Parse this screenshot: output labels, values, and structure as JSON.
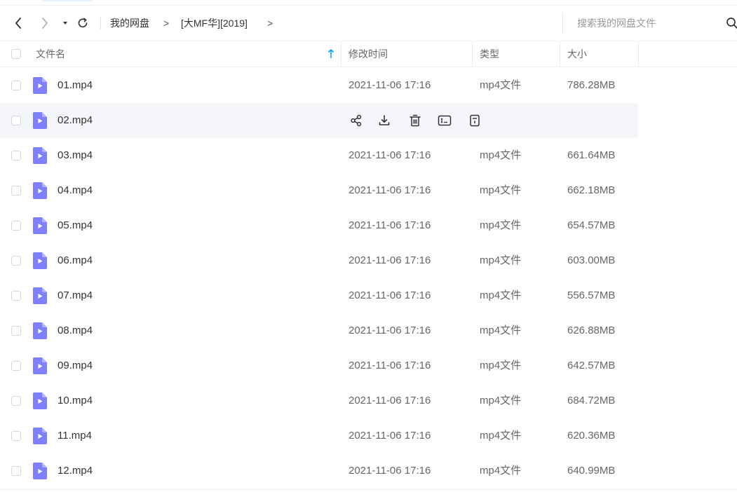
{
  "breadcrumb": {
    "root": "我的网盘",
    "separator": ">",
    "folder": "[大MF华][2019]",
    "trailing": ">"
  },
  "search": {
    "placeholder": "搜索我的网盘文件"
  },
  "columns": {
    "name": "文件名",
    "modified": "修改时间",
    "type": "类型",
    "size": "大小"
  },
  "sort": {
    "column": "name",
    "direction": "ascending"
  },
  "colors": {
    "accent": "#06a7ff",
    "file_icon": "#7e7ffa",
    "hover_row": "#f5f6fa"
  },
  "files": [
    {
      "name": "01.mp4",
      "modified": "2021-11-06 17:16",
      "type": "mp4文件",
      "size": "786.28MB"
    },
    {
      "name": "02.mp4",
      "modified": "",
      "type": "",
      "size": "",
      "hovered": true
    },
    {
      "name": "03.mp4",
      "modified": "2021-11-06 17:16",
      "type": "mp4文件",
      "size": "661.64MB"
    },
    {
      "name": "04.mp4",
      "modified": "2021-11-06 17:16",
      "type": "mp4文件",
      "size": "662.18MB"
    },
    {
      "name": "05.mp4",
      "modified": "2021-11-06 17:16",
      "type": "mp4文件",
      "size": "654.57MB"
    },
    {
      "name": "06.mp4",
      "modified": "2021-11-06 17:16",
      "type": "mp4文件",
      "size": "603.00MB"
    },
    {
      "name": "07.mp4",
      "modified": "2021-11-06 17:16",
      "type": "mp4文件",
      "size": "556.57MB"
    },
    {
      "name": "08.mp4",
      "modified": "2021-11-06 17:16",
      "type": "mp4文件",
      "size": "626.88MB"
    },
    {
      "name": "09.mp4",
      "modified": "2021-11-06 17:16",
      "type": "mp4文件",
      "size": "642.57MB"
    },
    {
      "name": "10.mp4",
      "modified": "2021-11-06 17:16",
      "type": "mp4文件",
      "size": "684.72MB"
    },
    {
      "name": "11.mp4",
      "modified": "2021-11-06 17:16",
      "type": "mp4文件",
      "size": "620.36MB"
    },
    {
      "name": "12.mp4",
      "modified": "2021-11-06 17:16",
      "type": "mp4文件",
      "size": "640.99MB"
    }
  ],
  "hover_actions": [
    "share-icon",
    "download-icon",
    "delete-icon",
    "rename-icon",
    "more-icon"
  ]
}
